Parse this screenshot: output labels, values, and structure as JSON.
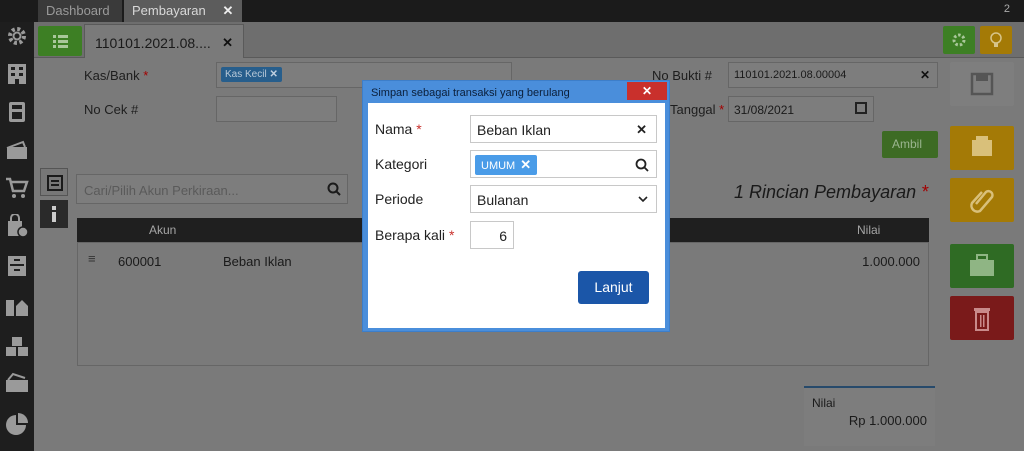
{
  "topbar": {
    "tabs": [
      {
        "label": "Dashboard"
      },
      {
        "label": "Pembayaran"
      }
    ],
    "close_label": "✕",
    "window_count": "2"
  },
  "subtabs": {
    "doc_tab_label": "110101.2021.08....",
    "doc_tab_close": "✕"
  },
  "form": {
    "kas_bank_label": "Kas/Bank",
    "kas_bank_value": "Kas Kecil",
    "no_cek_label": "No Cek #",
    "no_bukti_label": "No Bukti #",
    "no_bukti_value": "110101.2021.08.00004",
    "tanggal_label": "Tanggal",
    "tanggal_value": "31/08/2021",
    "required_mark": "*",
    "ambil_label": "Ambil"
  },
  "detail": {
    "title": "1 Rincian Pembayaran",
    "required_mark": "*",
    "search_placeholder": "Cari/Pilih Akun Perkiraan...",
    "columns": [
      "Akun",
      "Nilai"
    ],
    "rows": [
      {
        "akun": "600001",
        "nama": "Beban Iklan",
        "nilai": "1.000.000"
      }
    ]
  },
  "total": {
    "label": "Nilai",
    "value": "Rp 1.000.000"
  },
  "modal": {
    "title": "Simpan sebagai transaksi yang berulang",
    "close_label": "✕",
    "nama_label": "Nama",
    "nama_value": "Beban Iklan",
    "kategori_label": "Kategori",
    "kategori_chip": "UMUM",
    "periode_label": "Periode",
    "periode_value": "Bulanan",
    "berapa_label": "Berapa kali",
    "berapa_value": "6",
    "required_mark": "*",
    "submit_label": "Lanjut"
  },
  "colors": {
    "accent_green": "#3d7f24",
    "accent_blue": "#1b56a8",
    "modal_header": "#4a8edb",
    "danger": "#c9302c"
  }
}
